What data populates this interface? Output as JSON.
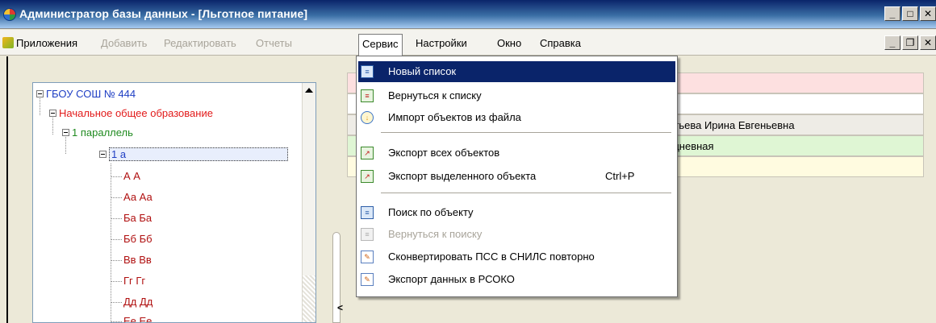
{
  "window": {
    "title": "Администратор базы данных - [Льготное питание]",
    "buttons": [
      "_",
      "□",
      "✕"
    ]
  },
  "menubar": {
    "items": [
      {
        "label": "Приложения",
        "disabled": false
      },
      {
        "label": "Добавить",
        "disabled": true
      },
      {
        "label": "Редактировать",
        "disabled": true
      },
      {
        "label": "Отчеты",
        "disabled": true
      },
      {
        "label": "Сервис",
        "disabled": false,
        "open": true
      },
      {
        "label": "Настройки",
        "disabled": false
      },
      {
        "label": "Окно",
        "disabled": false
      },
      {
        "label": "Справка",
        "disabled": false
      }
    ],
    "mdi_buttons": [
      "_",
      "❐",
      "✕"
    ]
  },
  "tree": {
    "school": "ГБОУ СОШ № 444",
    "level": "Начальное общее образование",
    "parallel": "1 параллель",
    "class": "1 а",
    "students": [
      "А А",
      "Аа Аа",
      "Ба Ба",
      "Бб Бб",
      "Вв Вв",
      "Гг Гг",
      "Дд Дд",
      "Ее Ее"
    ]
  },
  "right_rows": [
    {
      "text": "",
      "color": "#fde0e0"
    },
    {
      "text": "",
      "color": "#ffffff"
    },
    {
      "text": "ентьева Ирина Евгеньевна",
      "color": "#eeece6"
    },
    {
      "text": "тидневная",
      "color": "#dff6d4"
    },
    {
      "text": "",
      "color": "#fffbe0"
    }
  ],
  "service_menu": {
    "items": [
      {
        "label": "Новый список",
        "icon": "list-icon",
        "highlighted": true,
        "disabled": false
      },
      {
        "label": "Вернуться к списку",
        "icon": "return-list-icon",
        "highlighted": false,
        "disabled": false
      },
      {
        "label": "Импорт объектов из файла",
        "icon": "import-icon",
        "highlighted": false,
        "disabled": false
      },
      {
        "label": "Экспорт всех объектов",
        "icon": "export-icon",
        "highlighted": false,
        "disabled": false
      },
      {
        "label": "Экспорт выделенного объекта",
        "icon": "export-icon",
        "highlighted": false,
        "disabled": false,
        "shortcut": "Ctrl+P"
      },
      {
        "label": "Поиск по объекту",
        "icon": "search-list-icon",
        "highlighted": false,
        "disabled": false
      },
      {
        "label": "Вернуться к поиску",
        "icon": "return-search-icon",
        "highlighted": false,
        "disabled": true
      },
      {
        "label": "Сконвертировать ПСС в СНИЛС повторно",
        "icon": "convert-icon",
        "highlighted": false,
        "disabled": false
      },
      {
        "label": "Экспорт данных в РСОКО",
        "icon": "export-rsoko-icon",
        "highlighted": false,
        "disabled": false
      }
    ]
  },
  "colors": {
    "titlebar_start": "#0a246a",
    "highlight": "#0a246a",
    "tree_school": "#1f3fc4",
    "tree_level": "#e21a1a",
    "tree_parallel": "#1f8a1f",
    "tree_student": "#b01010"
  }
}
